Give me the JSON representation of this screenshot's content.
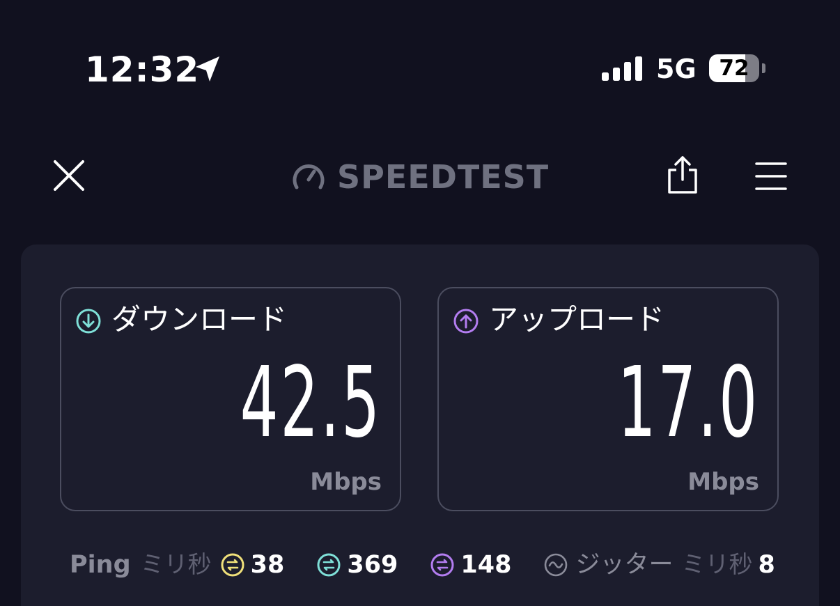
{
  "status_bar": {
    "time": "12:32",
    "location_icon": "location-arrow-icon",
    "signal_icon": "cellular-signal-icon",
    "network": "5G",
    "battery_level": "72"
  },
  "header": {
    "close_icon": "close-icon",
    "logo_icon": "speedometer-gauge-icon",
    "logo_text": "SPEEDTEST",
    "logo_tm": "™",
    "share_icon": "share-icon",
    "menu_icon": "hamburger-menu-icon"
  },
  "results": {
    "download": {
      "icon": "arrow-down-circle-icon",
      "label": "ダウンロード",
      "value": "42.5",
      "unit": "Mbps",
      "accent_color": "#7fe0d8"
    },
    "upload": {
      "icon": "arrow-up-circle-icon",
      "label": "アップロード",
      "value": "17.0",
      "unit": "Mbps",
      "accent_color": "#b37df0"
    },
    "ping": {
      "label": "Ping",
      "unit": "ミリ秒",
      "idle": {
        "icon": "idle-ping-icon",
        "value": "38",
        "color": "#f0e07a"
      },
      "download": {
        "icon": "download-ping-icon",
        "value": "369",
        "color": "#7fe0d8"
      },
      "upload": {
        "icon": "upload-ping-icon",
        "value": "148",
        "color": "#b37df0"
      }
    },
    "jitter": {
      "icon": "jitter-wave-icon",
      "label": "ジッター",
      "unit": "ミリ秒",
      "value": "8"
    }
  },
  "colors": {
    "background": "#11111f",
    "panel": "#1c1d2d",
    "card_border": "#4b4d5f",
    "muted_text": "#8a8b99"
  }
}
